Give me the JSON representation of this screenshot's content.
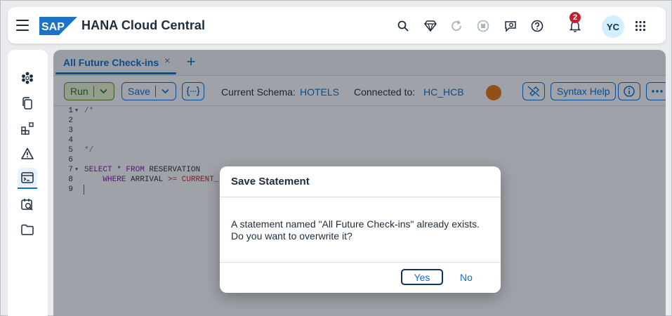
{
  "shell": {
    "title": "HANA Cloud Central",
    "logo_text": "SAP",
    "notification_count": "2",
    "avatar_initials": "YC",
    "icons": [
      "menu-icon",
      "search-icon",
      "diamond-icon",
      "refresh-icon",
      "stop-icon",
      "feedback-icon",
      "help-icon",
      "bell-icon",
      "product-switch-icon"
    ]
  },
  "sidenav": {
    "items": [
      "instances-icon",
      "copy-icon",
      "tools-icon",
      "alerts-icon",
      "sql-console-icon",
      "scheduler-icon",
      "folder-icon"
    ],
    "active_index": 4
  },
  "tabs": [
    {
      "label": "All Future Check-ins",
      "close": "×"
    }
  ],
  "tab_add": "+",
  "toolbar": {
    "run_label": "Run",
    "save_label": "Save",
    "schema_label": "Current Schema:",
    "schema_value": "HOTELS",
    "connected_label": "Connected to:",
    "connected_value": "HC_HCB",
    "syntax_help_label": "Syntax Help"
  },
  "editor": {
    "line_numbers": [
      "1",
      "2",
      "3",
      "4",
      "5",
      "6",
      "7",
      "8",
      "9"
    ],
    "lines": {
      "l1": "/*",
      "l5": "*/",
      "l7_kw1": "SELECT",
      "l7_star": " * ",
      "l7_kw2": "FROM",
      "l7_rest": " RESERVATION",
      "l8_indent": "    ",
      "l8_kw": "WHERE",
      "l8_col": " ARRIVAL ",
      "l8_op": ">=",
      "l8_fn": " CURRENT_"
    }
  },
  "dialog": {
    "title": "Save Statement",
    "message_line1": "A statement named \"All Future Check-ins\" already exists.",
    "message_line2": "Do you want to overwrite it?",
    "yes_label": "Yes",
    "no_label": "No"
  },
  "colors": {
    "accent": "#0a6ed1",
    "run_bg": "#ebf5cb",
    "status_dot": "#e9730c",
    "badge": "#c0212a"
  }
}
